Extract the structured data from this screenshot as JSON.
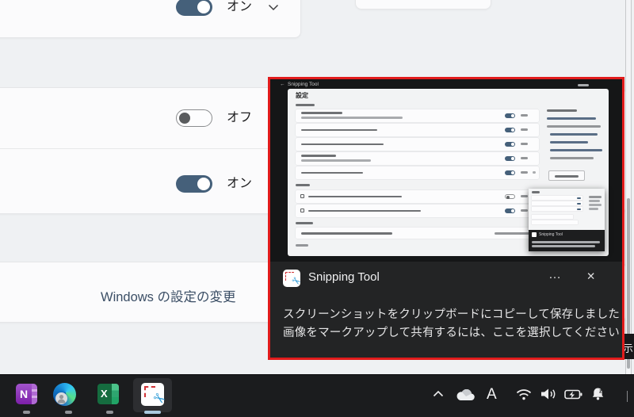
{
  "page": {
    "toggle_rows": [
      {
        "label": "オン",
        "state": "on"
      },
      {
        "label": "オフ",
        "state": "off"
      },
      {
        "label": "オン",
        "state": "on"
      }
    ],
    "change_settings_link": "Windows の設定の変更"
  },
  "notification": {
    "title": "Snipping Tool",
    "more": "…",
    "close": "✕",
    "line1": "スクリーンショットをクリップボードにコピーして保存しました",
    "line2": "画像をマークアップして共有するには、ここを選択してください",
    "border_color": "#e11c1c",
    "thumbnail": {
      "back": "←",
      "window_title": "Snipping Tool",
      "heading": "設定",
      "nested_title": "Snipping Tool"
    }
  },
  "peek": {
    "text": "示"
  },
  "taskbar": {
    "apps": [
      {
        "name": "OneNote",
        "letter": "N"
      },
      {
        "name": "Microsoft Edge"
      },
      {
        "name": "Excel",
        "letter": "X"
      },
      {
        "name": "Snipping Tool",
        "active": true
      }
    ],
    "tray": {
      "ime": "A"
    }
  },
  "icons": {
    "snipping_tool": "scissors-over-dashed-selection",
    "onedrive": "cloud",
    "wifi": "wifi-arcs",
    "volume": "speaker-waves",
    "battery": "battery-charging",
    "bell": "bell-do-not-disturb",
    "chevron_up": "^",
    "chevron_down": "v"
  },
  "colors": {
    "toggle_accent": "#45607a",
    "red_border": "#e11c1c",
    "active_indicator": "#a9c9de",
    "page_bg": "#eff1f3",
    "taskbar_bg": "#1b1c1e"
  }
}
